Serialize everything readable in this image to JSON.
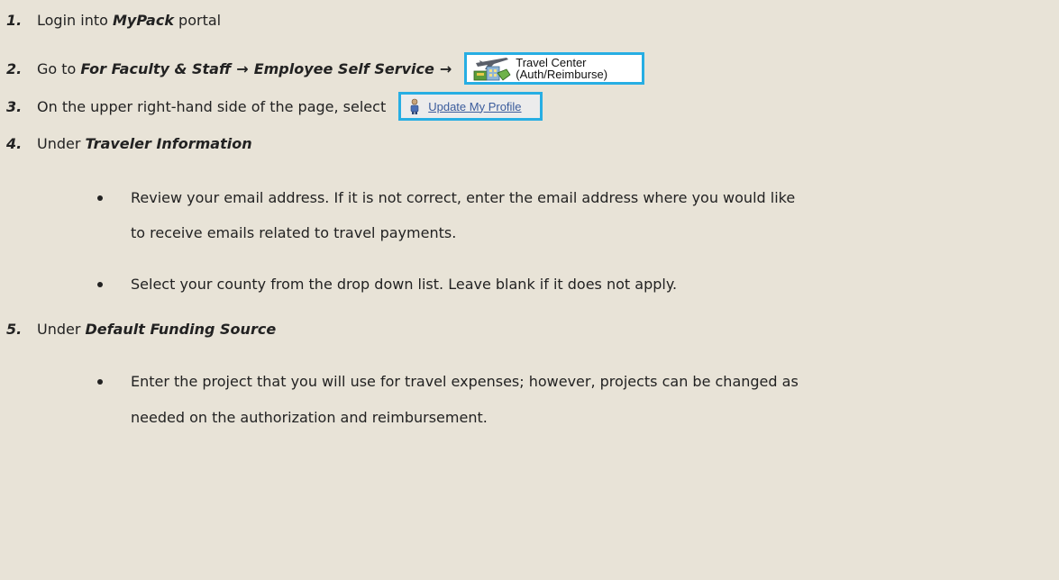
{
  "steps": [
    {
      "number": "1.",
      "pre": "Login into ",
      "bold": "MyPack",
      "post": " portal"
    },
    {
      "number": "2.",
      "pre": "Go to ",
      "path1": "For Faculty & Staff",
      "arrow1": "→",
      "path2": "Employee Self Service",
      "arrow2": "→",
      "button": {
        "line1": "Travel Center",
        "line2": "(Auth/Reimburse)",
        "icon": "airplane-luggage-icon"
      }
    },
    {
      "number": "3.",
      "text": "On the upper right-hand side of the page, select",
      "link": {
        "label": "Update My Profile",
        "icon": "person-icon"
      }
    },
    {
      "number": "4.",
      "pre": "Under ",
      "bold": "Traveler Information",
      "bullets": [
        {
          "line1": "Review your email address.  If it is not correct, enter the email address where you would like",
          "line2": "to receive emails related to travel payments."
        },
        {
          "line1": "Select your county from the drop down list. Leave blank if it does not apply."
        }
      ]
    },
    {
      "number": "5.",
      "pre": "Under ",
      "bold": "Default Funding Source",
      "bullets": [
        {
          "line1": "Enter the project that you will use for travel expenses; however, projects can be changed as",
          "line2": "needed on the authorization and reimbursement."
        }
      ]
    }
  ],
  "colors": {
    "background": "#e8e3d7",
    "highlight_border": "#27aee3",
    "link": "#3b5c9c"
  }
}
